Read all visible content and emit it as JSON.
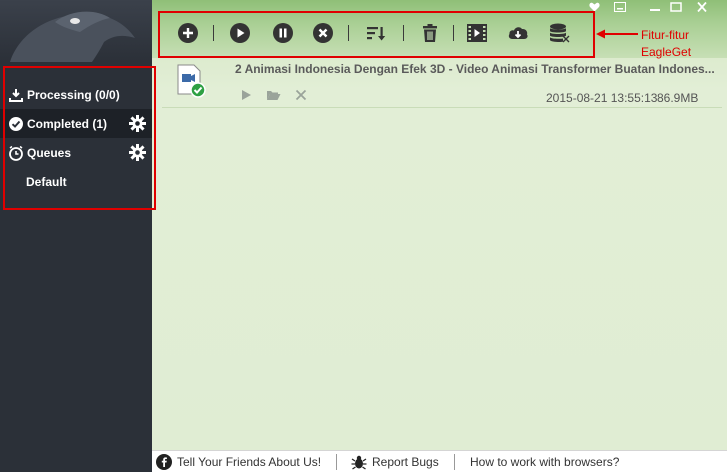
{
  "sidebar": {
    "items": [
      {
        "label": "Processing (0/0)",
        "icon": "download-icon"
      },
      {
        "label": "Completed (1)",
        "icon": "check-circle-icon",
        "active": true
      },
      {
        "label": "Queues",
        "icon": "clock-icon"
      },
      {
        "label": "Default"
      }
    ]
  },
  "toolbar": {
    "buttons": [
      "add-icon",
      "play-icon",
      "pause-icon",
      "stop-icon",
      "sort-icon",
      "trash-icon",
      "video-icon",
      "cloud-download-icon",
      "database-icon"
    ]
  },
  "download": {
    "title": "2 Animasi Indonesia Dengan Efek 3D - Video Animasi Transformer Buatan Indones...",
    "date": "2015-08-21 13:55:13",
    "size": "86.9MB"
  },
  "annotation": {
    "line1": "Fitur-fitur",
    "line2": "EagleGet"
  },
  "footer": {
    "share": "Tell Your Friends About Us!",
    "bugs": "Report Bugs",
    "help": "How to work with browsers?"
  },
  "colors": {
    "sidebar_bg": "#2b3038",
    "accent_green": "#2ea043",
    "annotation_red": "#e00000"
  }
}
